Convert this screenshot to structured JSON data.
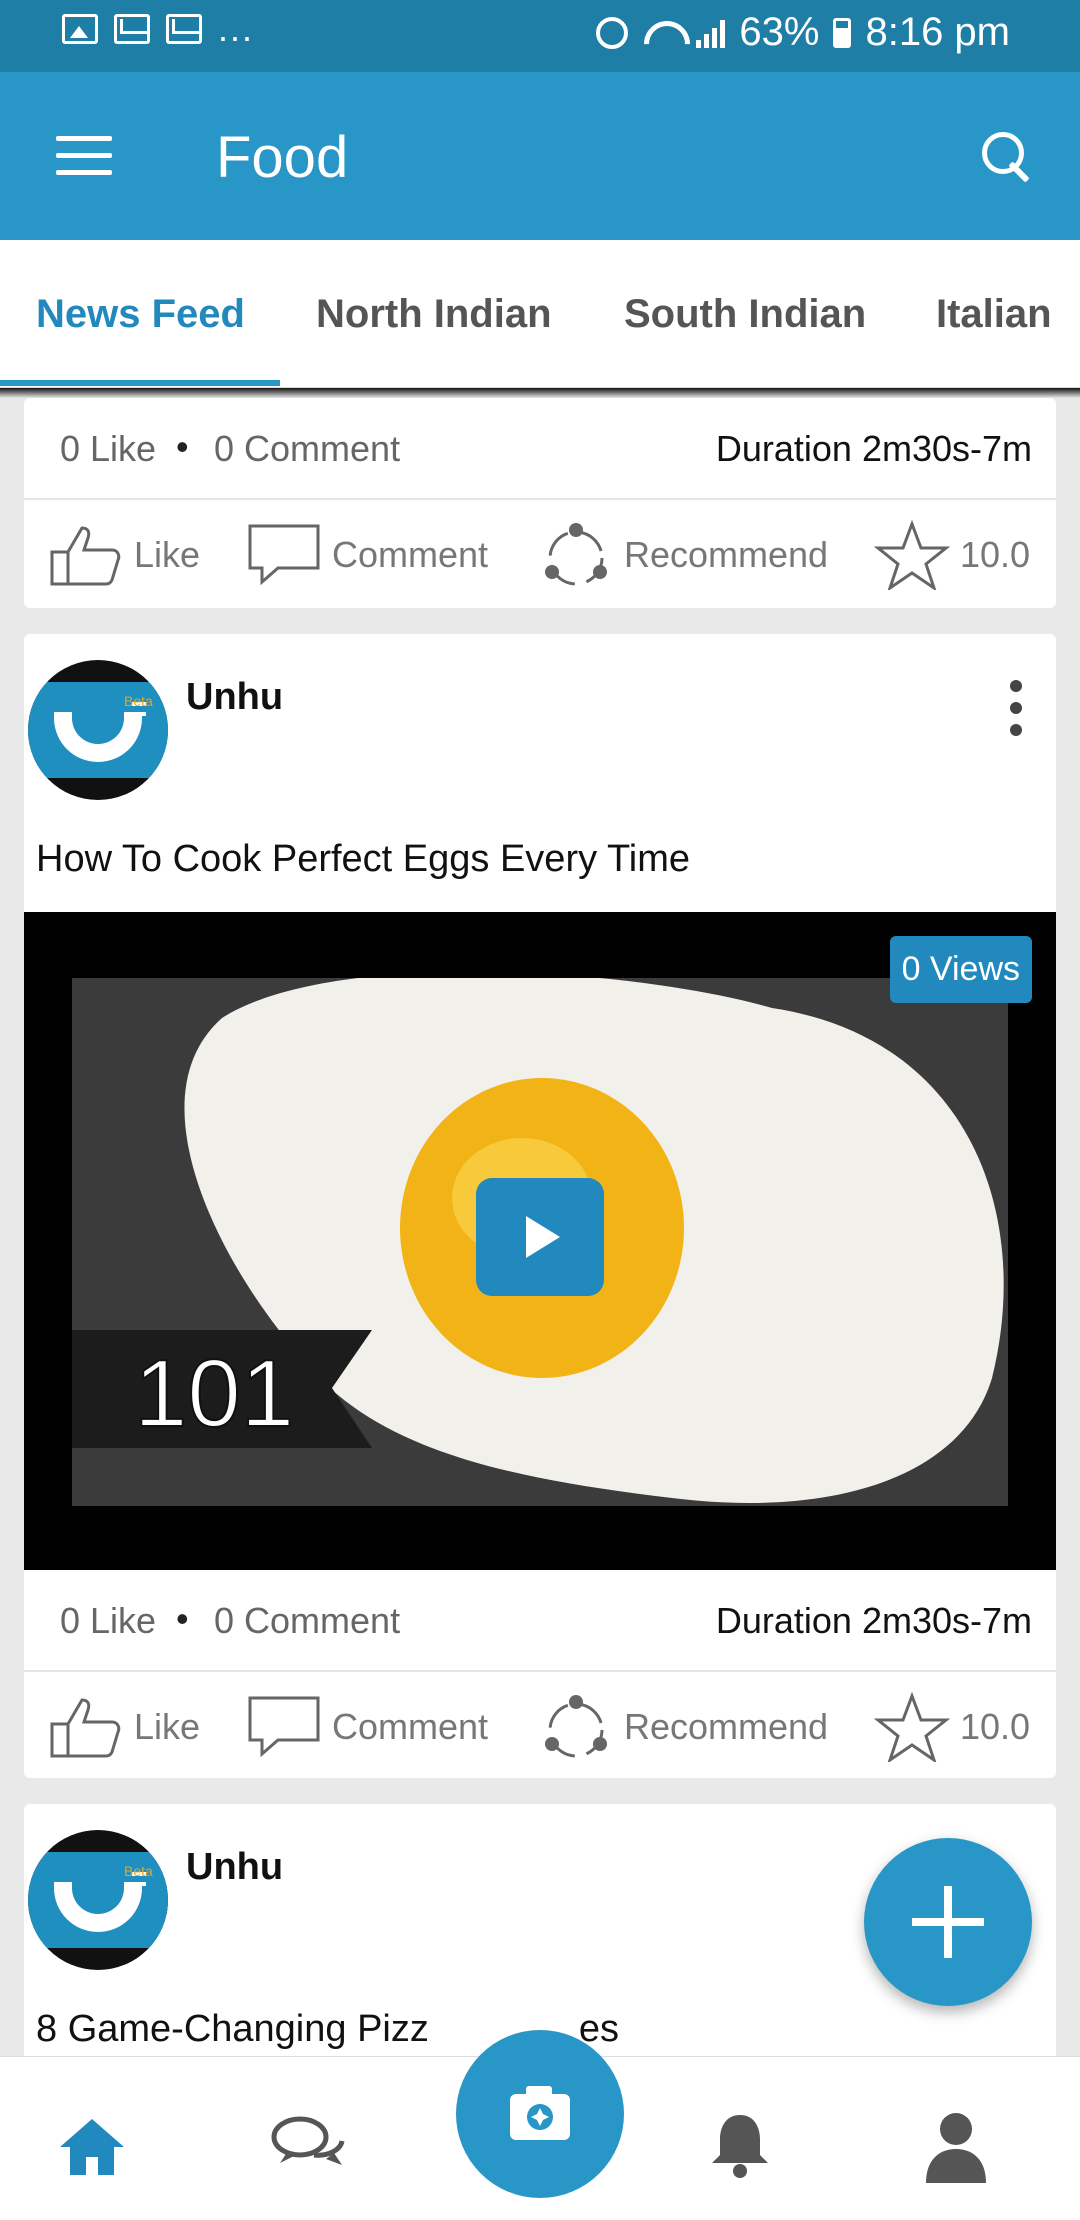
{
  "status_bar": {
    "battery": "63%",
    "time": "8:16 pm",
    "more": "..."
  },
  "app_bar": {
    "title": "Food"
  },
  "tabs": [
    {
      "label": "News Feed",
      "active": true
    },
    {
      "label": "North Indian",
      "active": false
    },
    {
      "label": "South Indian",
      "active": false
    },
    {
      "label": "Italian",
      "active": false
    }
  ],
  "posts": [
    {
      "likes": "0 Like",
      "comments": "0 Comment",
      "duration": "Duration 2m30s-7m",
      "actions": {
        "like": "Like",
        "comment": "Comment",
        "recommend": "Recommend",
        "rating": "10.0"
      }
    },
    {
      "author": "Unhu",
      "title": "How To Cook Perfect Eggs Every Time",
      "views": "0 Views",
      "thumbnail_text": "101",
      "likes": "0 Like",
      "comments": "0 Comment",
      "duration": "Duration 2m30s-7m",
      "actions": {
        "like": "Like",
        "comment": "Comment",
        "recommend": "Recommend",
        "rating": "10.0"
      }
    },
    {
      "author": "Unhu",
      "title": "8 Game-Changing Pizz",
      "title_tail": "es"
    }
  ],
  "avatar_badge": "Beta",
  "colors": {
    "primary": "#2896c6",
    "primary_dark": "#1f7ea6",
    "accent_text": "#2189bd"
  },
  "bottom_nav": [
    "home-icon",
    "chat-icon",
    "camera-icon",
    "bell-icon",
    "profile-icon"
  ]
}
